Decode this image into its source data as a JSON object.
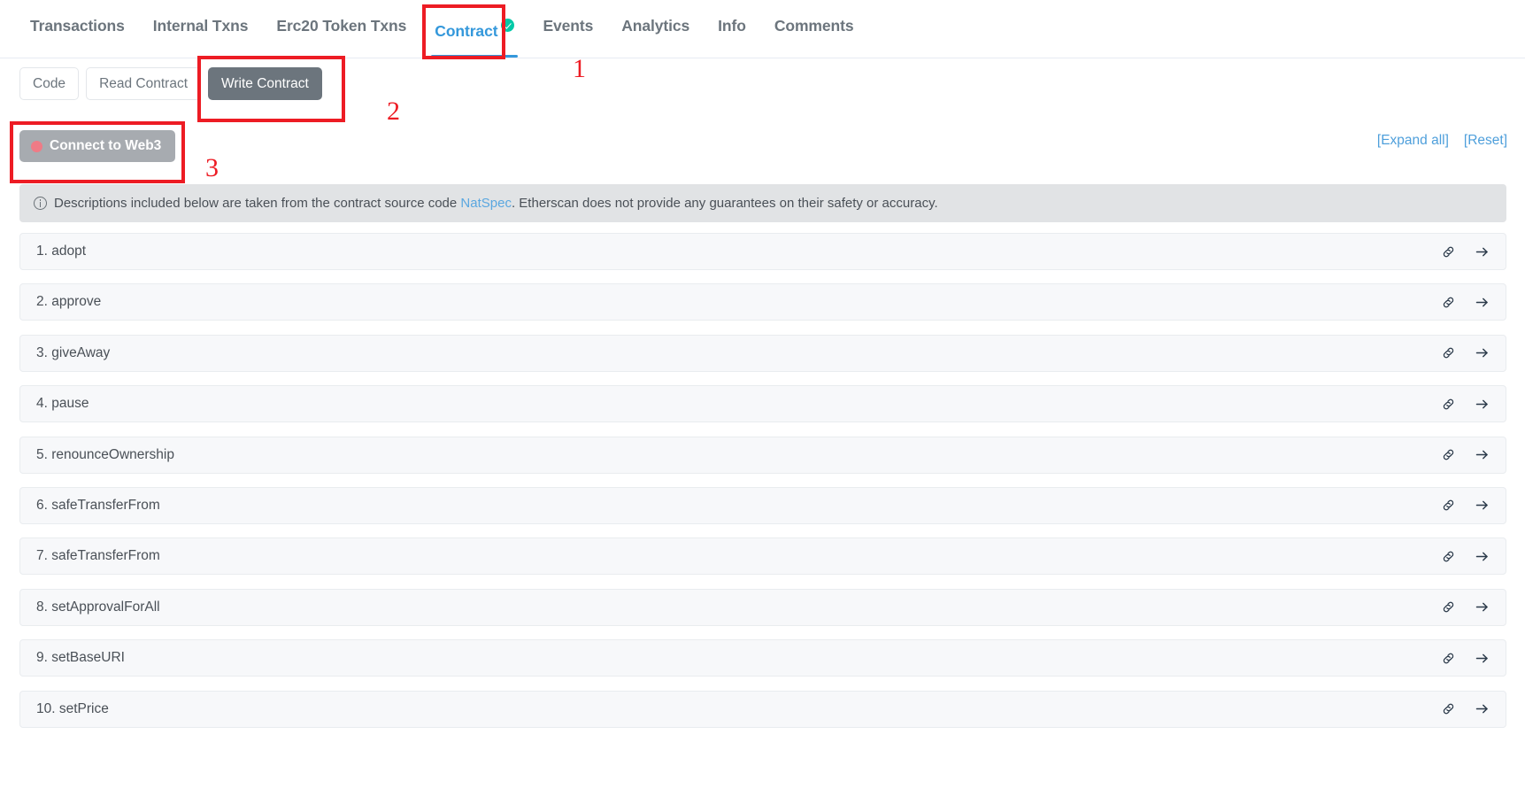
{
  "tabs": [
    {
      "label": "Transactions",
      "active": false,
      "verified": false
    },
    {
      "label": "Internal Txns",
      "active": false,
      "verified": false
    },
    {
      "label": "Erc20 Token Txns",
      "active": false,
      "verified": false
    },
    {
      "label": "Contract",
      "active": true,
      "verified": true
    },
    {
      "label": "Events",
      "active": false,
      "verified": false
    },
    {
      "label": "Analytics",
      "active": false,
      "verified": false
    },
    {
      "label": "Info",
      "active": false,
      "verified": false
    },
    {
      "label": "Comments",
      "active": false,
      "verified": false
    }
  ],
  "subtabs": [
    {
      "label": "Code",
      "active": false
    },
    {
      "label": "Read Contract",
      "active": false
    },
    {
      "label": "Write Contract",
      "active": true
    }
  ],
  "connect": {
    "label": "Connect to Web3",
    "dot_color": "#ef7b86",
    "button_color": "#a7abb0"
  },
  "toplinks": {
    "expand_all": "[Expand all]",
    "reset": "[Reset]",
    "link_color": "#4e9fdb"
  },
  "notice": {
    "icon": "info-circle-icon",
    "text_before": "Descriptions included below are taken from the contract source code",
    "link_text": "NatSpec",
    "text_after": ". Etherscan does not provide any guarantees on their safety or accuracy.",
    "background": "#e1e3e5"
  },
  "functions": [
    {
      "index": "1.",
      "name": "adopt"
    },
    {
      "index": "2.",
      "name": "approve"
    },
    {
      "index": "3.",
      "name": "giveAway"
    },
    {
      "index": "4.",
      "name": "pause"
    },
    {
      "index": "5.",
      "name": "renounceOwnership"
    },
    {
      "index": "6.",
      "name": "safeTransferFrom"
    },
    {
      "index": "7.",
      "name": "safeTransferFrom"
    },
    {
      "index": "8.",
      "name": "setApprovalForAll"
    },
    {
      "index": "9.",
      "name": "setBaseURI"
    },
    {
      "index": "10.",
      "name": "setPrice"
    }
  ],
  "row_icons": {
    "link": "link-icon",
    "arrow": "arrow-right-icon"
  },
  "annotations": {
    "color": "#ed1c24",
    "markers": [
      {
        "number": "1",
        "target": "contract-tab"
      },
      {
        "number": "2",
        "target": "write-contract-button"
      },
      {
        "number": "3",
        "target": "connect-to-web3-button"
      }
    ]
  }
}
